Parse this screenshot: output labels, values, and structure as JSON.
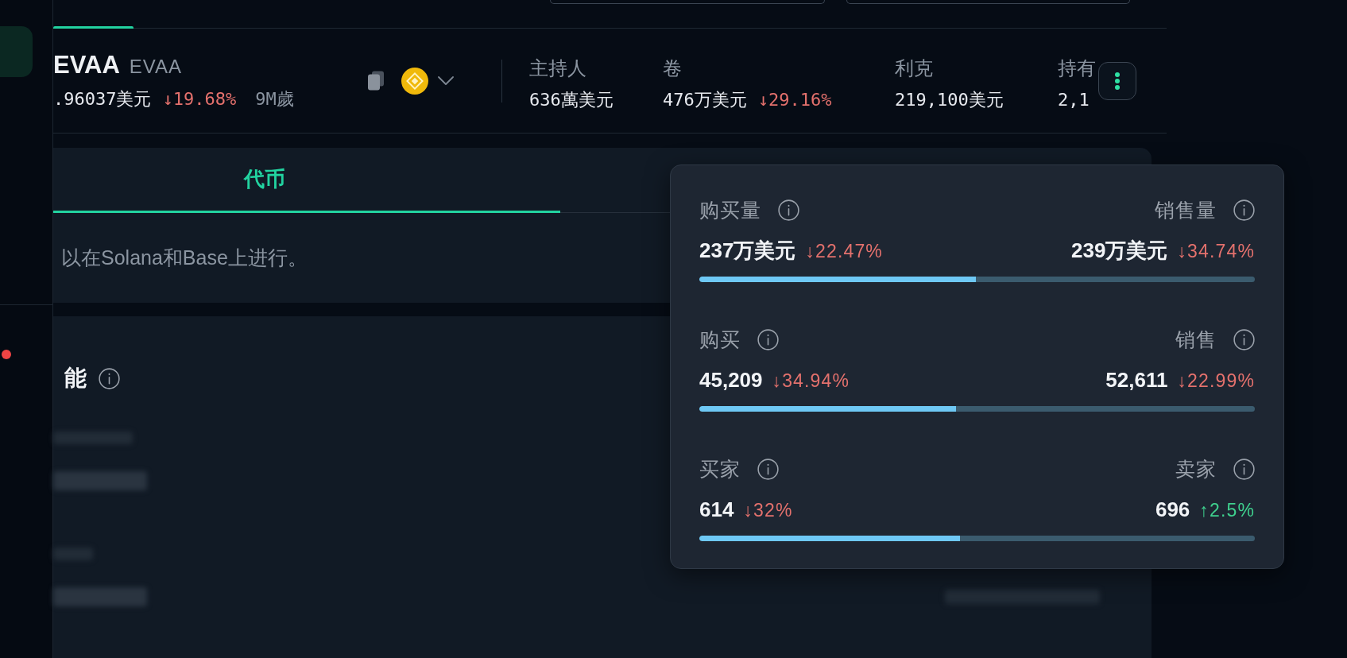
{
  "sidebar": {
    "items": [
      {
        "selected": true,
        "alert": false
      },
      {
        "selected": false,
        "alert": true
      }
    ]
  },
  "top_tabs": [
    {
      "selected": true
    }
  ],
  "token": {
    "name": "EVAA",
    "symbol": "EVAA",
    "price": ".96037美元",
    "change": {
      "text": "↓19.68%",
      "kind": "down"
    },
    "age": "9M歲"
  },
  "stats": [
    {
      "label": "主持人",
      "value": "636萬美元"
    },
    {
      "label": "卷",
      "value": "476万美元",
      "change": {
        "text": "↓29.16%",
        "kind": "down"
      }
    },
    {
      "label": "利克",
      "value": "219,100美元"
    },
    {
      "label": "持有",
      "value": "2,1"
    }
  ],
  "panel": {
    "tabs": [
      {
        "label": "代币",
        "selected": true
      }
    ],
    "description": "以在Solana和Base上进行。"
  },
  "section": {
    "title": "能"
  },
  "trade_stats": [
    {
      "left": {
        "label": "购买量",
        "value": "237万美元",
        "change": {
          "text": "↓22.47%",
          "kind": "down"
        }
      },
      "right": {
        "label": "销售量",
        "value": "239万美元",
        "change": {
          "text": "↓34.74%",
          "kind": "down"
        }
      },
      "level": 0.498
    },
    {
      "left": {
        "label": "购买",
        "value": "45,209",
        "change": {
          "text": "↓34.94%",
          "kind": "down"
        }
      },
      "right": {
        "label": "销售",
        "value": "52,611",
        "change": {
          "text": "↓22.99%",
          "kind": "down"
        }
      },
      "level": 0.462
    },
    {
      "left": {
        "label": "买家",
        "value": "614",
        "change": {
          "text": "↓32%",
          "kind": "down"
        }
      },
      "right": {
        "label": "卖家",
        "value": "696",
        "change": {
          "text": "↑2.5%",
          "kind": "up"
        }
      },
      "level": 0.469
    }
  ]
}
